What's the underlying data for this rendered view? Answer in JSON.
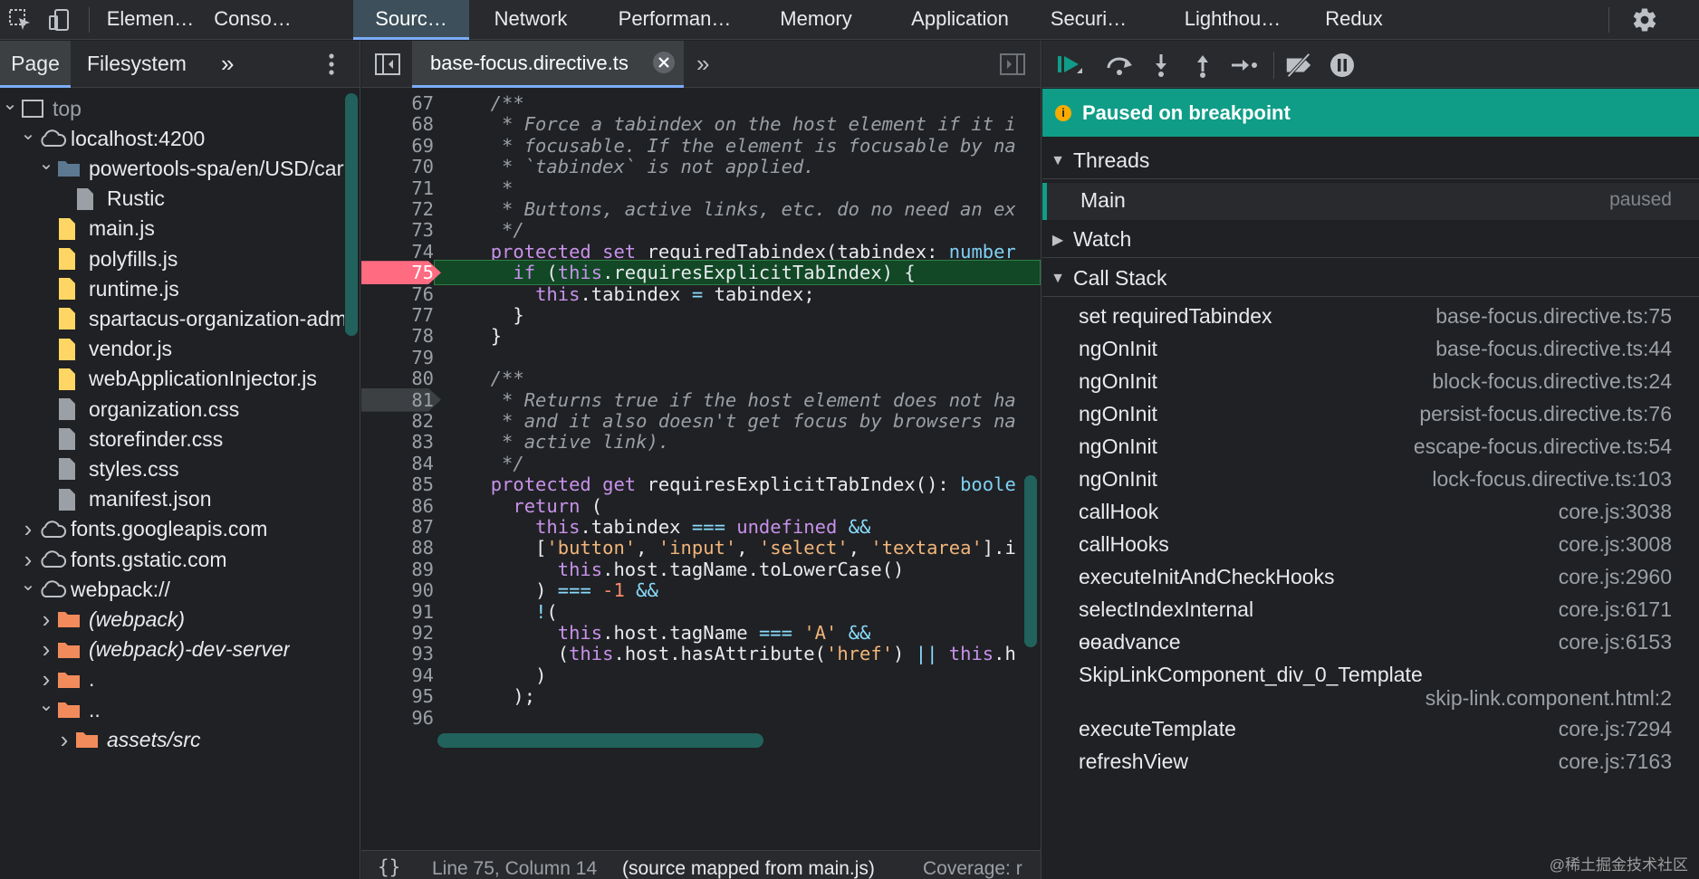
{
  "topbar": {
    "tabs": [
      {
        "label": "Elemen…"
      },
      {
        "label": "Conso…"
      },
      {
        "label": "Sourc…"
      },
      {
        "label": "Network"
      },
      {
        "label": "Performan…"
      },
      {
        "label": "Memory"
      },
      {
        "label": "Application"
      },
      {
        "label": "Securi…"
      },
      {
        "label": "Lighthou…"
      },
      {
        "label": "Redux"
      }
    ],
    "active_tab": "Sourc…"
  },
  "navigator": {
    "tabs": [
      {
        "label": "Page"
      },
      {
        "label": "Filesystem"
      }
    ],
    "more": "»",
    "tree": [
      {
        "label": "top",
        "kind": "frame",
        "expanded": true,
        "depth": 0
      },
      {
        "label": "localhost:4200",
        "kind": "cloud",
        "expanded": true,
        "depth": 1
      },
      {
        "label": "powertools-spa/en/USD/cart",
        "kind": "folder-blue",
        "expanded": true,
        "depth": 2
      },
      {
        "label": "Rustic",
        "kind": "file-gray",
        "depth": 3
      },
      {
        "label": "main.js",
        "kind": "file-yellow",
        "depth": 2
      },
      {
        "label": "polyfills.js",
        "kind": "file-yellow",
        "depth": 2
      },
      {
        "label": "runtime.js",
        "kind": "file-yellow",
        "depth": 2
      },
      {
        "label": "spartacus-organization-administration.js",
        "kind": "file-yellow",
        "depth": 2
      },
      {
        "label": "vendor.js",
        "kind": "file-yellow",
        "depth": 2
      },
      {
        "label": "webApplicationInjector.js",
        "kind": "file-yellow",
        "depth": 2
      },
      {
        "label": "organization.css",
        "kind": "file-gray",
        "depth": 2
      },
      {
        "label": "storefinder.css",
        "kind": "file-gray",
        "depth": 2
      },
      {
        "label": "styles.css",
        "kind": "file-gray",
        "depth": 2
      },
      {
        "label": "manifest.json",
        "kind": "file-gray",
        "depth": 2
      },
      {
        "label": "fonts.googleapis.com",
        "kind": "cloud",
        "expanded": false,
        "depth": 1
      },
      {
        "label": "fonts.gstatic.com",
        "kind": "cloud",
        "expanded": false,
        "depth": 1
      },
      {
        "label": "webpack://",
        "kind": "cloud",
        "expanded": true,
        "depth": 1
      },
      {
        "label": "(webpack)",
        "kind": "folder-orange",
        "expanded": false,
        "depth": 2,
        "italic": true
      },
      {
        "label": "(webpack)-dev-server",
        "kind": "folder-orange",
        "expanded": false,
        "depth": 2,
        "italic": true
      },
      {
        "label": ".",
        "kind": "folder-orange",
        "expanded": false,
        "depth": 2
      },
      {
        "label": "..",
        "kind": "folder-orange",
        "expanded": true,
        "depth": 2
      },
      {
        "label": "assets/src",
        "kind": "folder-orange",
        "expanded": false,
        "depth": 3,
        "italic": true
      }
    ]
  },
  "editor": {
    "file_tab": "base-focus.directive.ts",
    "breakpoint_line": 75,
    "lines": [
      {
        "n": "67",
        "code": "  /**"
      },
      {
        "n": "68",
        "code": "   * Force a tabindex on the host element if it i"
      },
      {
        "n": "69",
        "code": "   * focusable. If the element is focusable by na"
      },
      {
        "n": "70",
        "code": "   * `tabindex` is not applied."
      },
      {
        "n": "71",
        "code": "   *"
      },
      {
        "n": "72",
        "code": "   * Buttons, active links, etc. do no need an ex"
      },
      {
        "n": "73",
        "code": "   */"
      },
      {
        "n": "74",
        "code": "  protected set requiredTabindex(tabindex: number"
      },
      {
        "n": "75",
        "code": "    if (this.requiresExplicitTabIndex) {"
      },
      {
        "n": "76",
        "code": "      this.tabindex = tabindex;"
      },
      {
        "n": "77",
        "code": "    }"
      },
      {
        "n": "78",
        "code": "  }"
      },
      {
        "n": "79",
        "code": ""
      },
      {
        "n": "80",
        "code": "  /**"
      },
      {
        "n": "81",
        "code": "   * Returns true if the host element does not ha"
      },
      {
        "n": "82",
        "code": "   * and it also doesn't get focus by browsers na"
      },
      {
        "n": "83",
        "code": "   * active link)."
      },
      {
        "n": "84",
        "code": "   */"
      },
      {
        "n": "85",
        "code": "  protected get requiresExplicitTabIndex(): boole"
      },
      {
        "n": "86",
        "code": "    return ("
      },
      {
        "n": "87",
        "code": "      this.tabindex === undefined &&"
      },
      {
        "n": "88",
        "code": "      ['button', 'input', 'select', 'textarea'].i"
      },
      {
        "n": "89",
        "code": "        this.host.tagName.toLowerCase()"
      },
      {
        "n": "90",
        "code": "      ) === -1 &&"
      },
      {
        "n": "91",
        "code": "      !("
      },
      {
        "n": "92",
        "code": "        this.host.tagName === 'A' &&"
      },
      {
        "n": "93",
        "code": "        (this.host.hasAttribute('href') || this.h"
      },
      {
        "n": "94",
        "code": "      )"
      },
      {
        "n": "95",
        "code": "    );"
      },
      {
        "n": "96",
        "code": ""
      }
    ],
    "status": {
      "braces": "{}",
      "position": "Line 75, Column 14",
      "mapping": "(source mapped from main.js)",
      "coverage": "Coverage: r"
    }
  },
  "debugger": {
    "banner": "Paused on breakpoint",
    "threads_label": "Threads",
    "thread": {
      "name": "Main",
      "state": "paused"
    },
    "watch_label": "Watch",
    "callstack_label": "Call Stack",
    "frames": [
      {
        "name": "set requiredTabindex",
        "loc": "base-focus.directive.ts:75"
      },
      {
        "name": "ngOnInit",
        "loc": "base-focus.directive.ts:44"
      },
      {
        "name": "ngOnInit",
        "loc": "block-focus.directive.ts:24"
      },
      {
        "name": "ngOnInit",
        "loc": "persist-focus.directive.ts:76"
      },
      {
        "name": "ngOnInit",
        "loc": "escape-focus.directive.ts:54"
      },
      {
        "name": "ngOnInit",
        "loc": "lock-focus.directive.ts:103"
      },
      {
        "name": "callHook",
        "loc": "core.js:3038"
      },
      {
        "name": "callHooks",
        "loc": "core.js:3008"
      },
      {
        "name": "executeInitAndCheckHooks",
        "loc": "core.js:2960"
      },
      {
        "name": "selectIndexInternal",
        "loc": "core.js:6171"
      },
      {
        "name": "ɵɵadvance",
        "loc": "core.js:6153"
      },
      {
        "name": "SkipLinkComponent_div_0_Template",
        "loc": "skip-link.component.html:2"
      },
      {
        "name": "executeTemplate",
        "loc": "core.js:7294"
      },
      {
        "name": "refreshView",
        "loc": "core.js:7163"
      }
    ],
    "watermark": "@稀土掘金技术社区"
  },
  "colors": {
    "accent": "#7cacf8",
    "paused_banner": "#0f9d88",
    "breakpoint": "#ff6b81",
    "exec_line": "#124826"
  }
}
